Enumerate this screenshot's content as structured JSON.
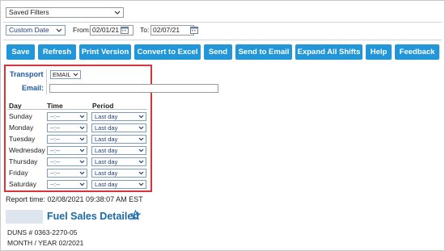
{
  "saved_filters": {
    "label": "Saved Filters"
  },
  "date_filter": {
    "range_selected": "Custom Date",
    "from_label": "From:",
    "from_value": "02/01/21",
    "to_label": "To:",
    "to_value": "02/07/21"
  },
  "toolbar": {
    "buttons": [
      "Save",
      "Refresh",
      "Print Version",
      "Convert to Excel",
      "Send",
      "Send to Email",
      "Expand All Shifts",
      "Help",
      "Feedback"
    ],
    "button_color": "#2196d8"
  },
  "schedule": {
    "transport_label": "Transport",
    "transport_value": "EMAIL",
    "email_label": "Email:",
    "email_value": "",
    "headers": {
      "day": "Day",
      "time": "Time",
      "period": "Period"
    },
    "rows": [
      {
        "day": "Sunday",
        "time": "--:--",
        "period": "Last day"
      },
      {
        "day": "Monday",
        "time": "--:--",
        "period": "Last day"
      },
      {
        "day": "Tuesday",
        "time": "--:--",
        "period": "Last day"
      },
      {
        "day": "Wednesday",
        "time": "--:--",
        "period": "Last day"
      },
      {
        "day": "Thursday",
        "time": "--:--",
        "period": "Last day"
      },
      {
        "day": "Friday",
        "time": "--:--",
        "period": "Last day"
      },
      {
        "day": "Saturday",
        "time": "--:--",
        "period": "Last day"
      }
    ],
    "highlight_color": "#d8343c"
  },
  "report": {
    "time_text": "Report time: 02/08/2021 09:38:07 AM EST",
    "title": "Fuel Sales Detailed",
    "duns": "DUNS # 0363-2270-05",
    "month_year": "MONTH / YEAR 02/2021",
    "title_color": "#1a6aa8"
  }
}
